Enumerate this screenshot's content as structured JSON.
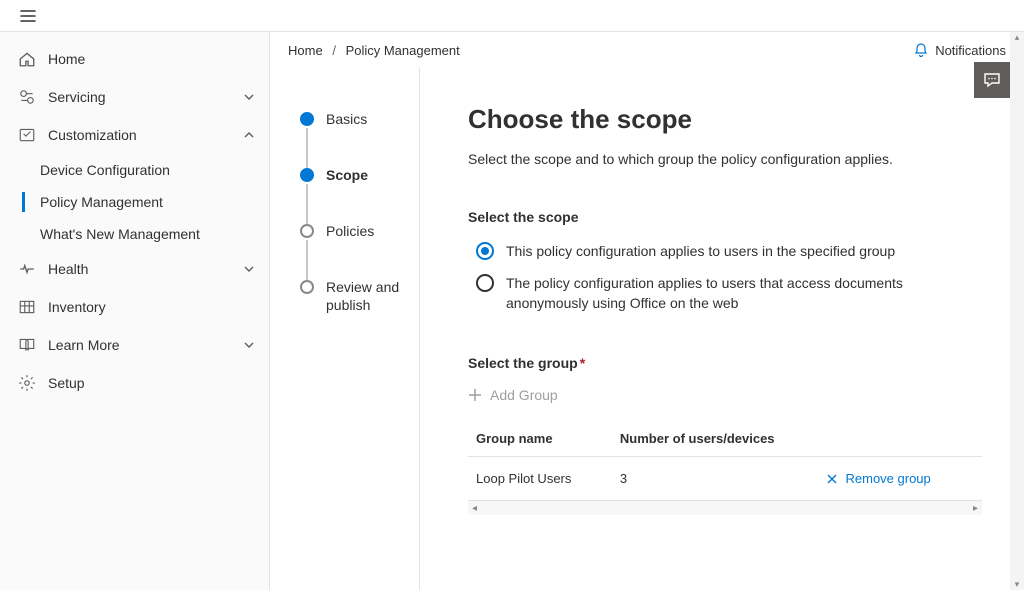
{
  "breadcrumb": {
    "root": "Home",
    "current": "Policy Management"
  },
  "notifications_label": "Notifications",
  "sidebar": {
    "items": [
      {
        "label": "Home"
      },
      {
        "label": "Servicing"
      },
      {
        "label": "Customization"
      },
      {
        "label": "Health"
      },
      {
        "label": "Inventory"
      },
      {
        "label": "Learn More"
      },
      {
        "label": "Setup"
      }
    ],
    "customization_children": [
      {
        "label": "Device Configuration"
      },
      {
        "label": "Policy Management"
      },
      {
        "label": "What's New Management"
      }
    ]
  },
  "stepper": [
    {
      "label": "Basics"
    },
    {
      "label": "Scope"
    },
    {
      "label": "Policies"
    },
    {
      "label": "Review and publish"
    }
  ],
  "page": {
    "title": "Choose the scope",
    "subtitle": "Select the scope and to which group the policy configuration applies."
  },
  "scope_section": {
    "heading": "Select the scope",
    "options": [
      "This policy configuration applies to users in the specified group",
      "The policy configuration applies to users that access documents anonymously using Office on the web"
    ]
  },
  "group_section": {
    "heading": "Select the group",
    "required_mark": "*",
    "add_label": "Add Group",
    "columns": {
      "name": "Group name",
      "count": "Number of users/devices"
    },
    "rows": [
      {
        "name": "Loop Pilot Users",
        "count": "3",
        "remove": "Remove group"
      }
    ]
  }
}
